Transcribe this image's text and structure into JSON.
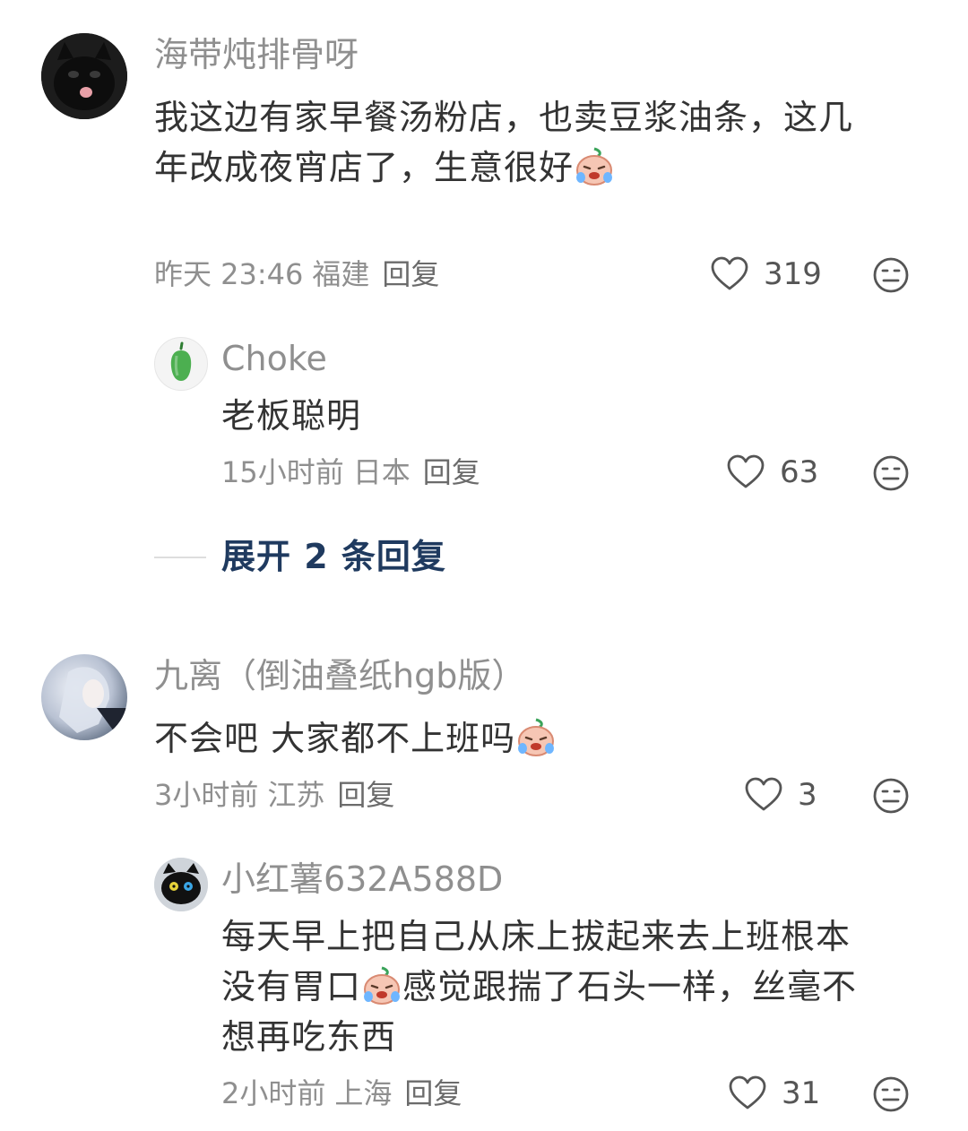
{
  "comments": [
    {
      "username": "海带炖排骨呀",
      "text_line1": "我这边有家早餐汤粉店，也卖豆浆油条，这几",
      "text_line2": "年改成夜宵店了，生意很好",
      "time": "昨天 23:46",
      "location": "福建",
      "reply_label": "回复",
      "likes": "319"
    },
    {
      "username": "Choke",
      "text": "老板聪明",
      "time": "15小时前",
      "location": "日本",
      "reply_label": "回复",
      "likes": "63"
    },
    {
      "expand_label": "展开 2 条回复"
    },
    {
      "username": "九离（倒油叠纸hgb版）",
      "text": "不会吧 大家都不上班吗",
      "time": "3小时前",
      "location": "江苏",
      "reply_label": "回复",
      "likes": "3"
    },
    {
      "username": "小红薯632A588D",
      "text_line1": "每天早上把自己从床上拔起来去上班根本",
      "text_line2a": "没有胃口",
      "text_line2b": "感觉跟揣了石头一样，丝毫不",
      "text_line3": "想再吃东西",
      "time": "2小时前",
      "location": "上海",
      "reply_label": "回复",
      "likes": "31"
    }
  ],
  "icons": {
    "like": "heart-outline-icon",
    "dislike": "neutral-face-icon",
    "emoji": "crying-laughing-sticker"
  },
  "colors": {
    "name": "#8f8f8f",
    "text": "#333333",
    "expand": "#1f3a5f"
  }
}
